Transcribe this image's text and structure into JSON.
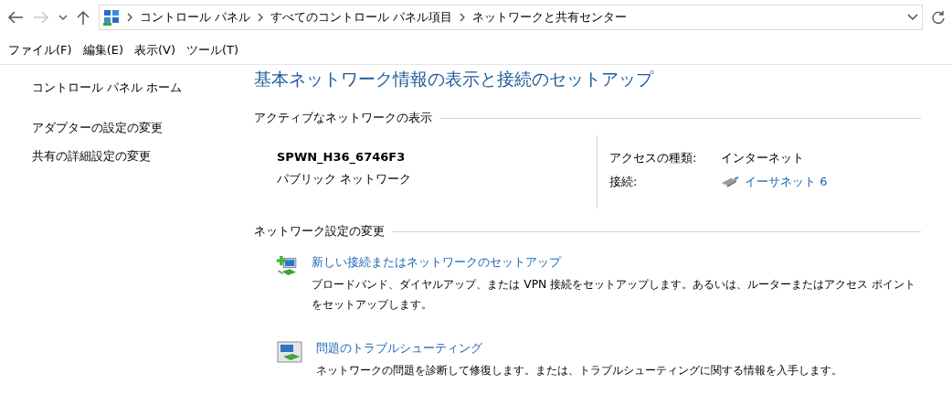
{
  "navigation": {
    "back_disabled": false,
    "forward_disabled": true
  },
  "address_bar": {
    "breadcrumbs": [
      "コントロール パネル",
      "すべてのコントロール パネル項目",
      "ネットワークと共有センター"
    ]
  },
  "menu_bar": [
    "ファイル(F)",
    "編集(E)",
    "表示(V)",
    "ツール(T)"
  ],
  "sidebar": {
    "home": "コントロール パネル ホーム",
    "items": [
      "アダプターの設定の変更",
      "共有の詳細設定の変更"
    ]
  },
  "title": "基本ネットワーク情報の表示と接続のセットアップ",
  "active_networks": {
    "heading": "アクティブなネットワークの表示",
    "name": "SPWN_H36_6746F3",
    "category": "パブリック ネットワーク",
    "details": [
      {
        "label": "アクセスの種類:",
        "value": "インターネット",
        "kind": "text"
      },
      {
        "label": "接続:",
        "value": "イーサネット 6",
        "kind": "link"
      }
    ]
  },
  "change_settings": {
    "heading": "ネットワーク設定の変更",
    "tasks": [
      {
        "kind": "new-connection",
        "title": "新しい接続またはネットワークのセットアップ",
        "description": "ブロードバンド、ダイヤルアップ、または VPN 接続をセットアップします。あるいは、ルーターまたはアクセス ポイントをセットアップします。"
      },
      {
        "kind": "troubleshoot",
        "title": "問題のトラブルシューティング",
        "description": "ネットワークの問題を診断して修復します。または、トラブルシューティングに関する情報を入手します。"
      }
    ]
  }
}
